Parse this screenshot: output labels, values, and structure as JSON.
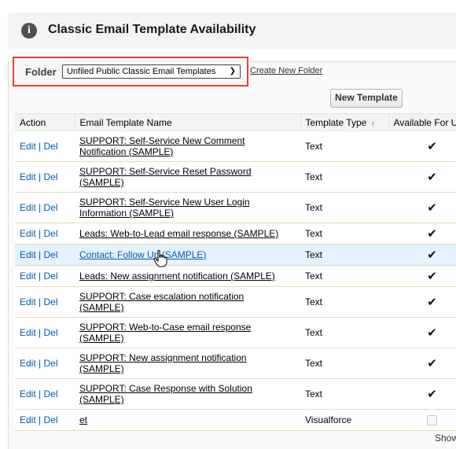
{
  "header": {
    "title": "Classic Email Template Availability",
    "icon": "info-icon"
  },
  "folder": {
    "label": "Folder",
    "selected": "Unfiled Public Classic Email Templates",
    "create_link": "Create New Folder",
    "highlight_color": "#e0413b"
  },
  "toolbar": {
    "new_template_label": "New Template"
  },
  "table": {
    "columns": {
      "action": "Action",
      "name": "Email Template Name",
      "type": "Template Type",
      "available": "Available For U"
    },
    "edit_label": "Edit",
    "sep": "|",
    "del_label": "Del",
    "rows": [
      {
        "name1": "SUPPORT: Self-Service New Comment",
        "name2": "Notification (SAMPLE)",
        "type": "Text",
        "available": true
      },
      {
        "name1": "SUPPORT: Self-Service Reset Password",
        "name2": "(SAMPLE)",
        "type": "Text",
        "available": true
      },
      {
        "name1": "SUPPORT: Self-Service New User Login",
        "name2": "Information (SAMPLE)",
        "type": "Text",
        "available": true
      },
      {
        "name1": "Leads: Web-to-Lead email response (SAMPLE)",
        "name2": "",
        "type": "Text",
        "available": true
      },
      {
        "name1": "Contact: Follow Up (SAMPLE)",
        "name2": "",
        "type": "Text",
        "available": true,
        "hover": true
      },
      {
        "name1": "Leads: New assignment notification (SAMPLE)",
        "name2": "",
        "type": "Text",
        "available": true
      },
      {
        "name1": "SUPPORT: Case escalation notification",
        "name2": "(SAMPLE)",
        "type": "Text",
        "available": true
      },
      {
        "name1": "SUPPORT: Web-to-Case email response",
        "name2": "(SAMPLE)",
        "type": "Text",
        "available": true
      },
      {
        "name1": "SUPPORT: New assignment notification",
        "name2": "(SAMPLE)",
        "type": "Text",
        "available": true
      },
      {
        "name1": "SUPPORT: Case Response with Solution",
        "name2": "(SAMPLE)",
        "type": "Text",
        "available": true
      },
      {
        "name1": "et",
        "name2": "",
        "type": "Visualforce",
        "available": false
      }
    ]
  },
  "footer": {
    "show_text": "Show"
  }
}
